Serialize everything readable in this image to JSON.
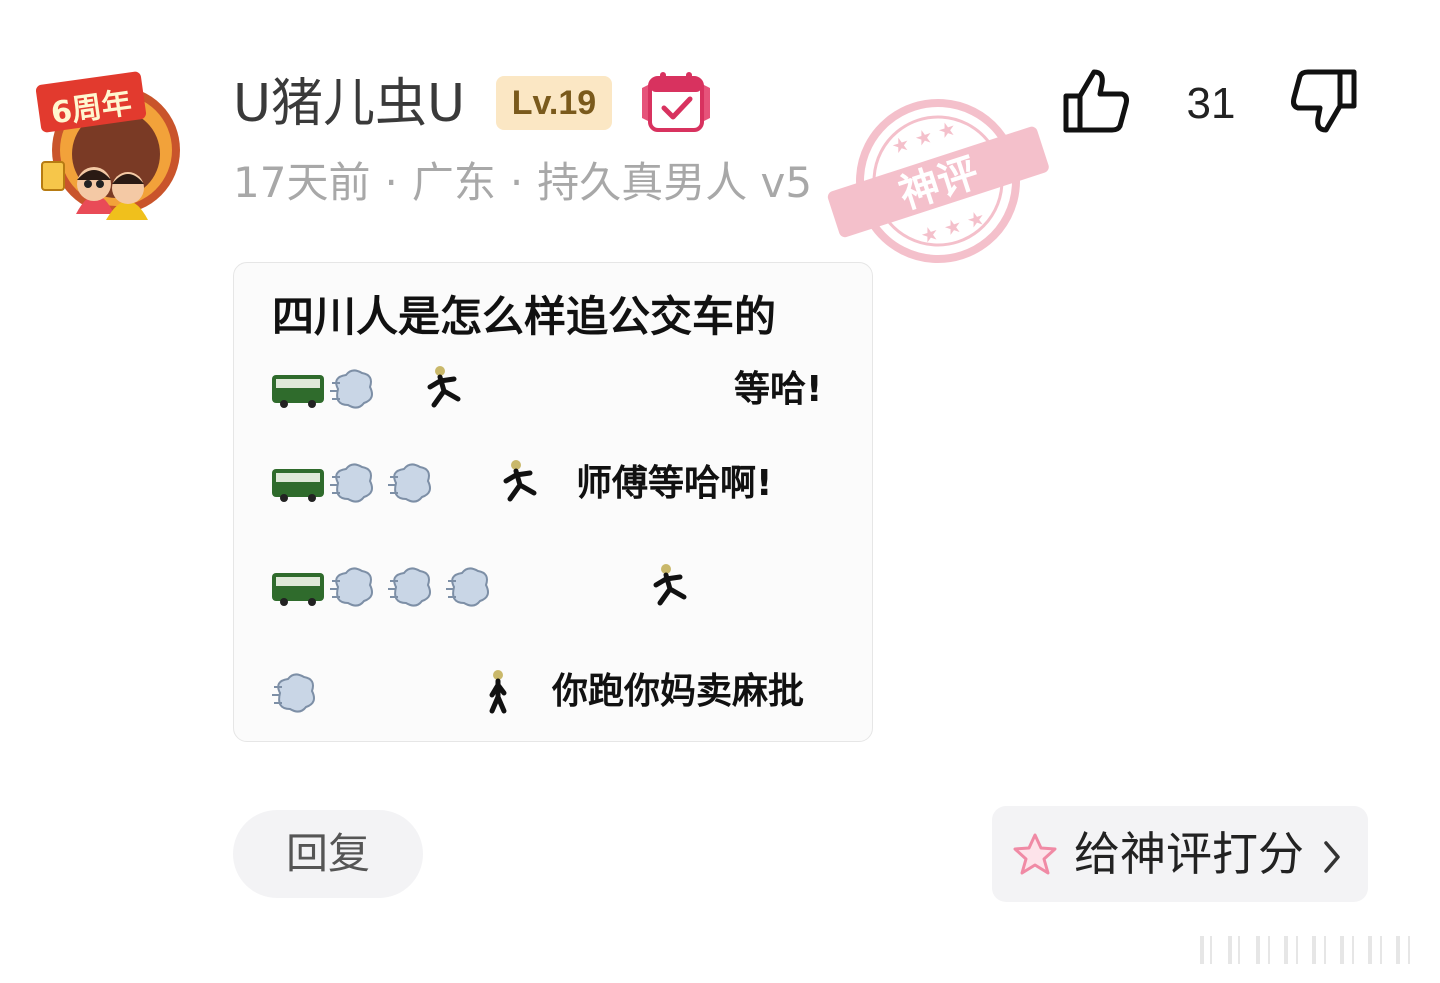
{
  "user": {
    "name": "U猪儿虫U",
    "level": "Lv.19",
    "avatar_badge_text": "6周年"
  },
  "meta": {
    "time": "17天前",
    "location": "广东",
    "title": "持久真男人 v5",
    "separator": "·"
  },
  "stamp_text": "神评",
  "votes": {
    "like_count": "31"
  },
  "image": {
    "title": "四川人是怎么样追公交车的",
    "rows": [
      {
        "text": "等哈!"
      },
      {
        "text": "师傅等哈啊!"
      },
      {
        "text": ""
      },
      {
        "text": "你跑你妈卖麻批"
      }
    ]
  },
  "actions": {
    "reply_label": "回复",
    "rate_label": "给神评打分"
  },
  "colors": {
    "bus_green": "#2f6b2c",
    "stamp_pink": "#f3b6c3",
    "star_pink": "#f08aa5",
    "level_bg": "#fbe7c4"
  }
}
